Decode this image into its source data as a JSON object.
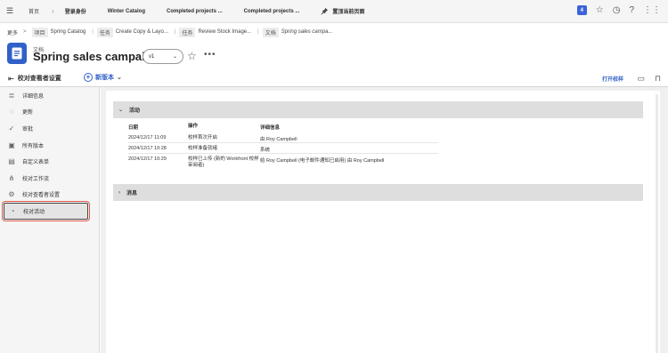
{
  "topnav": {
    "home": "首页",
    "tabs": [
      "登录身份",
      "Winter Catalog",
      "Completed projects ...",
      "Completed projects ..."
    ],
    "pin_label": "置顶当前页面",
    "badge": "4"
  },
  "breadcrumb": {
    "more": "更多",
    "items": [
      {
        "type": "项目",
        "label": "Spring Catalog"
      },
      {
        "type": "任务",
        "label": "Create Copy & Layo..."
      },
      {
        "type": "任务",
        "label": "Review Stock Image..."
      },
      {
        "type": "文档",
        "label": "Spring sales campa..."
      }
    ]
  },
  "header": {
    "type_label": "文档",
    "title": "Spring sales campaign",
    "version": "v1"
  },
  "toolbar": {
    "left_label": "校对查看者设置",
    "new_version": "新版本",
    "open_proof": "打开校样"
  },
  "sidebar": {
    "items": [
      {
        "label": "详细信息",
        "icon": "document-lines-icon"
      },
      {
        "label": "更新",
        "icon": "chat-bubble-icon"
      },
      {
        "label": "审批",
        "icon": "check-circle-icon"
      },
      {
        "label": "所有版本",
        "icon": "versions-icon"
      },
      {
        "label": "自定义表单",
        "icon": "form-icon"
      },
      {
        "label": "校对工作流",
        "icon": "workflow-icon"
      },
      {
        "label": "校对查看者设置",
        "icon": "gear-icon"
      },
      {
        "label": "校对活动",
        "icon": "activity-icon"
      }
    ],
    "active_index": 7
  },
  "activity": {
    "section_title": "活动",
    "columns": [
      "日期",
      "操作",
      "详细信息"
    ],
    "rows": [
      {
        "date": "2024/12/17 11:09",
        "action": "校样首次开启",
        "details": "由 Roy Campbell"
      },
      {
        "date": "2024/12/17 10:28",
        "action": "校样准备就绪",
        "details": "系统"
      },
      {
        "date": "2024/12/17 10:29",
        "action": "校样已上传 (新的 Workfront 校样审阅者)",
        "details": "给 Roy Campbell (电子邮件通知已启用) 由 Roy Campbell"
      }
    ]
  },
  "messages": {
    "section_title": "消息"
  }
}
